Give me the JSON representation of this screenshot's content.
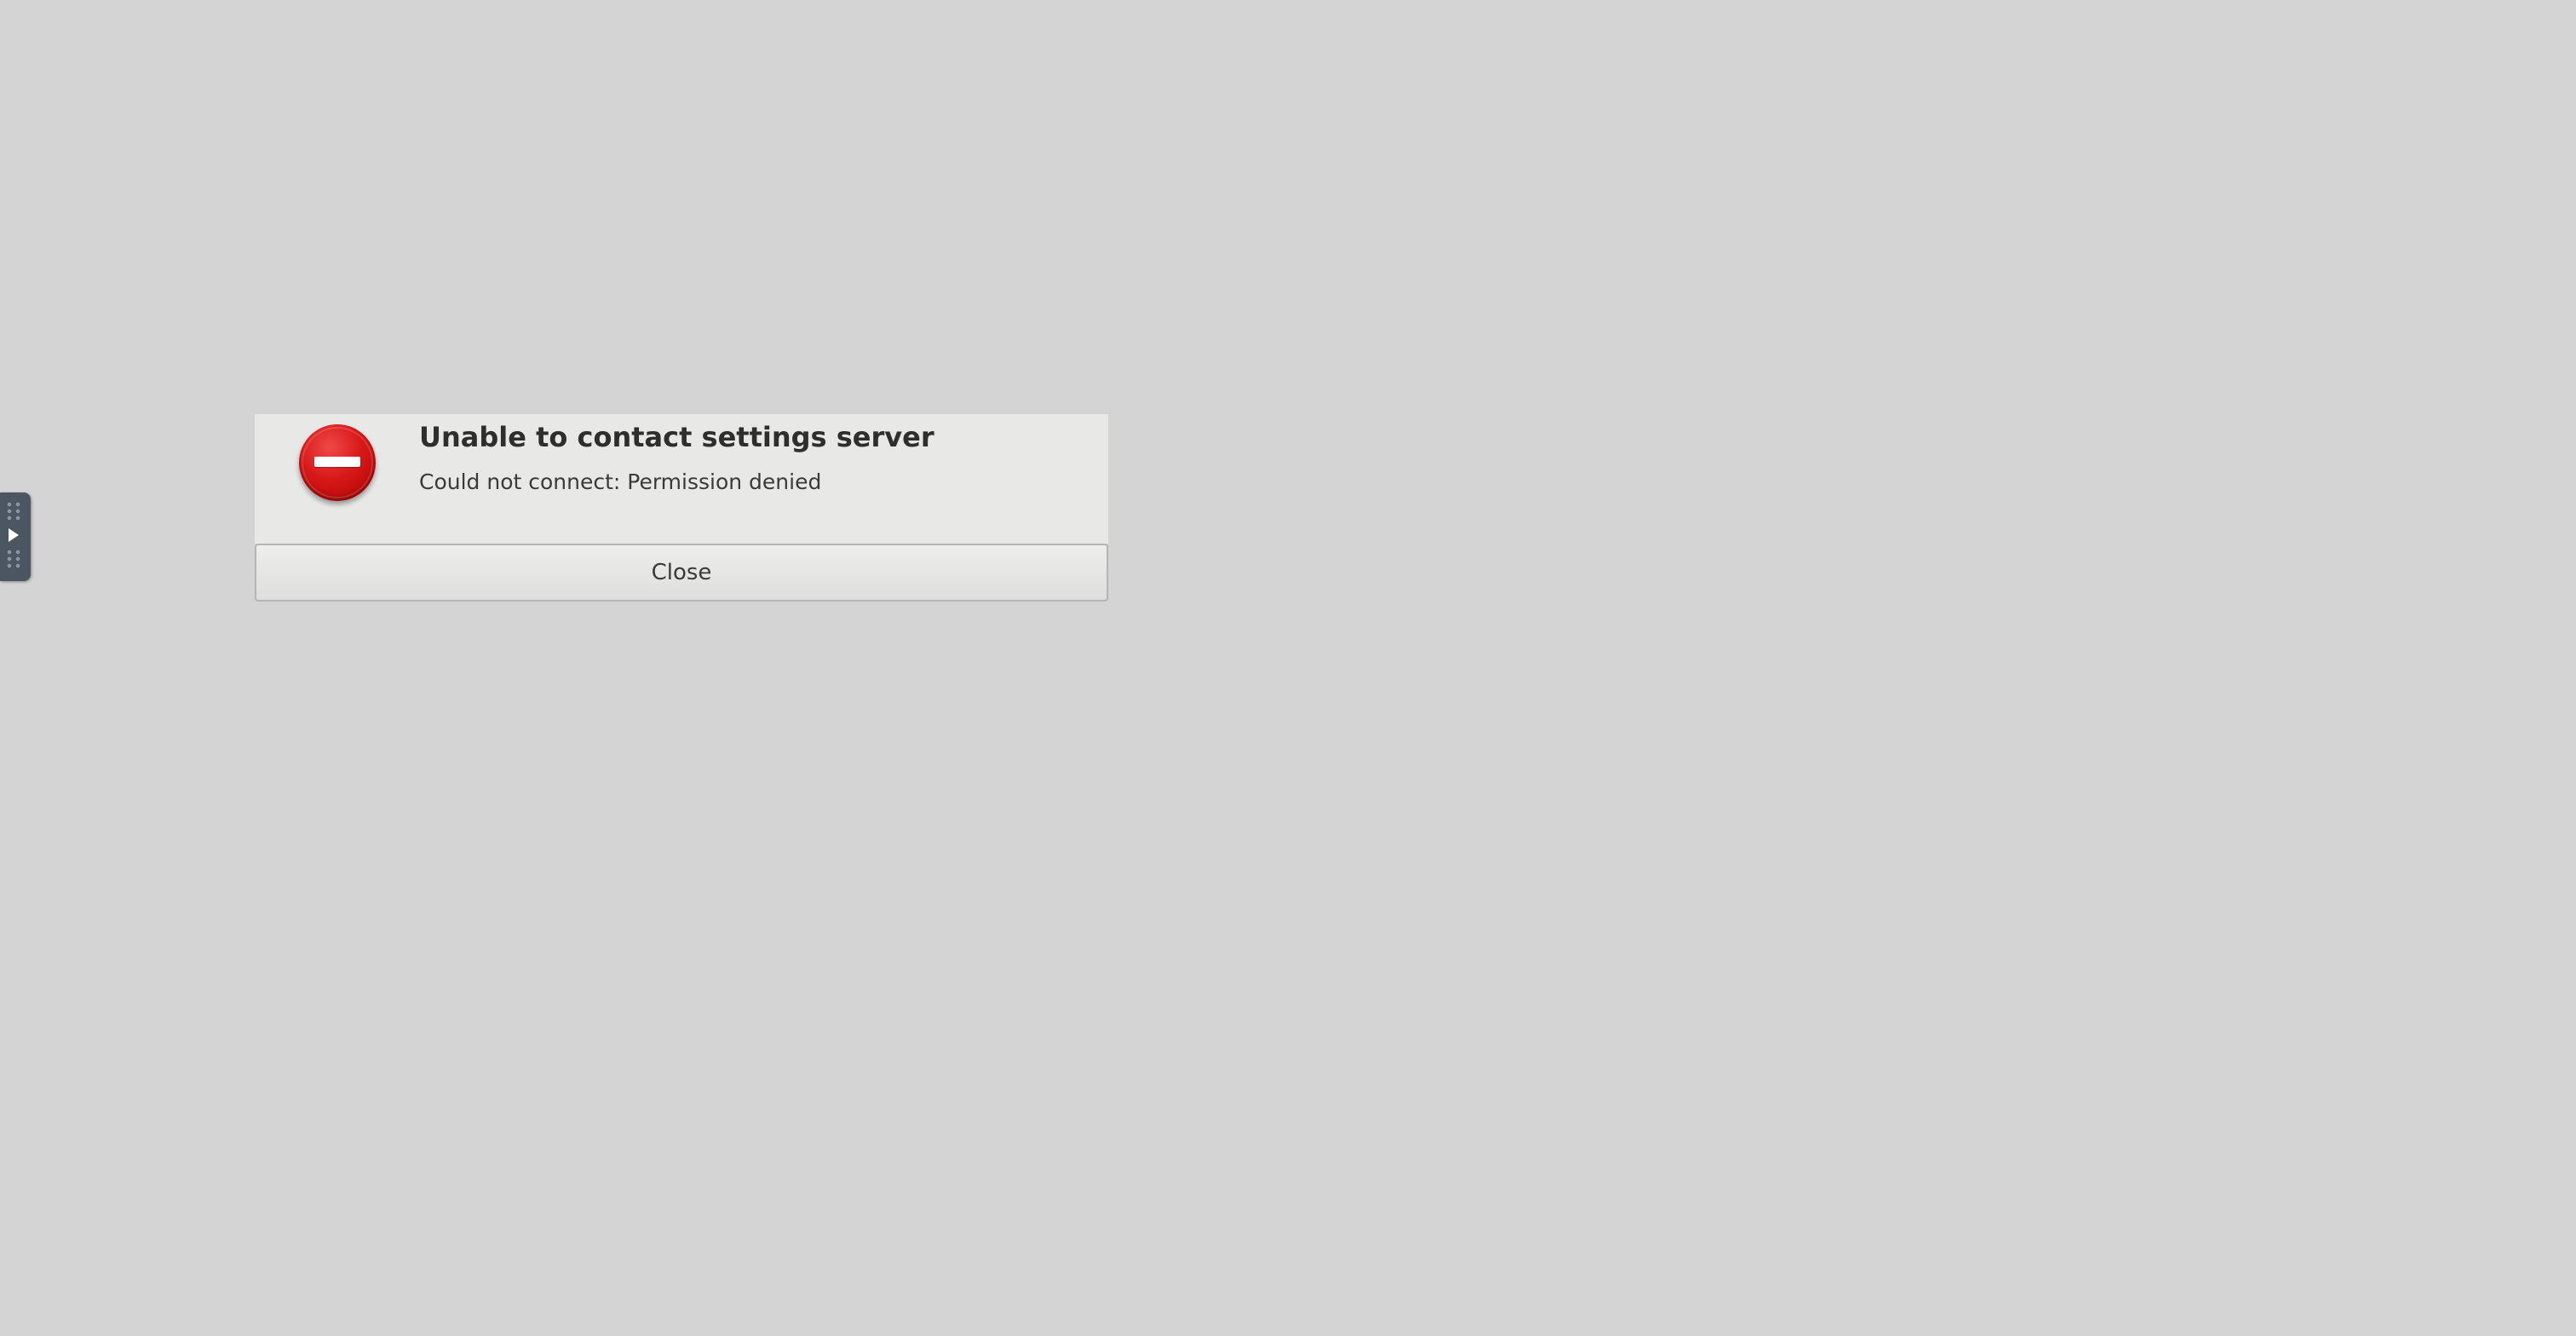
{
  "dialog": {
    "title": "Unable to contact settings server",
    "message": "Could not connect: Permission denied",
    "close_label": "Close",
    "icon": "error-icon"
  },
  "panel": {
    "icon": "arrow-right-icon"
  },
  "colors": {
    "desktop_background": "#d4d4d4",
    "dialog_background": "#e8e8e7",
    "error_red": "#d81818",
    "panel_handle": "#4c5662"
  }
}
